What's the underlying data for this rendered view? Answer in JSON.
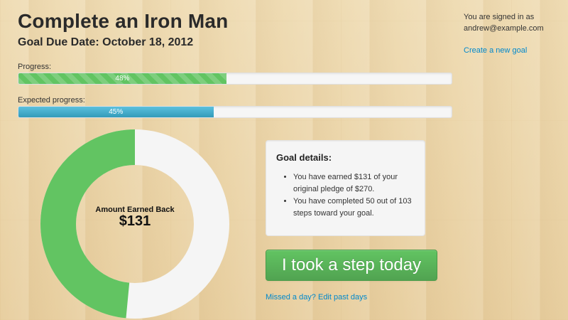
{
  "header": {
    "title": "Complete an Iron Man",
    "due_date": "Goal Due Date: October 18, 2012"
  },
  "progress": {
    "label": "Progress:",
    "percent_text": "48%",
    "value": 48,
    "color": "#62c462"
  },
  "expected_progress": {
    "label": "Expected progress:",
    "percent_text": "45%",
    "value": 45,
    "color": "#49afcd"
  },
  "donut": {
    "caption": "Amount Earned Back",
    "value_text": "$131",
    "earned": 131,
    "pledge": 270,
    "colors": {
      "earned": "#62c462",
      "remaining": "#f5f5f5"
    }
  },
  "goal_details": {
    "heading": "Goal details:",
    "items": [
      "You have earned $131 of your original pledge of $270.",
      "You have completed 50 out of 103 steps toward your goal."
    ]
  },
  "actions": {
    "step_button": "I took a step today",
    "missed_link": "Missed a day? Edit past days"
  },
  "sidebar": {
    "signed_in_label": "You are signed in as",
    "email": "andrew@example.com",
    "create_goal_link": "Create a new goal"
  }
}
